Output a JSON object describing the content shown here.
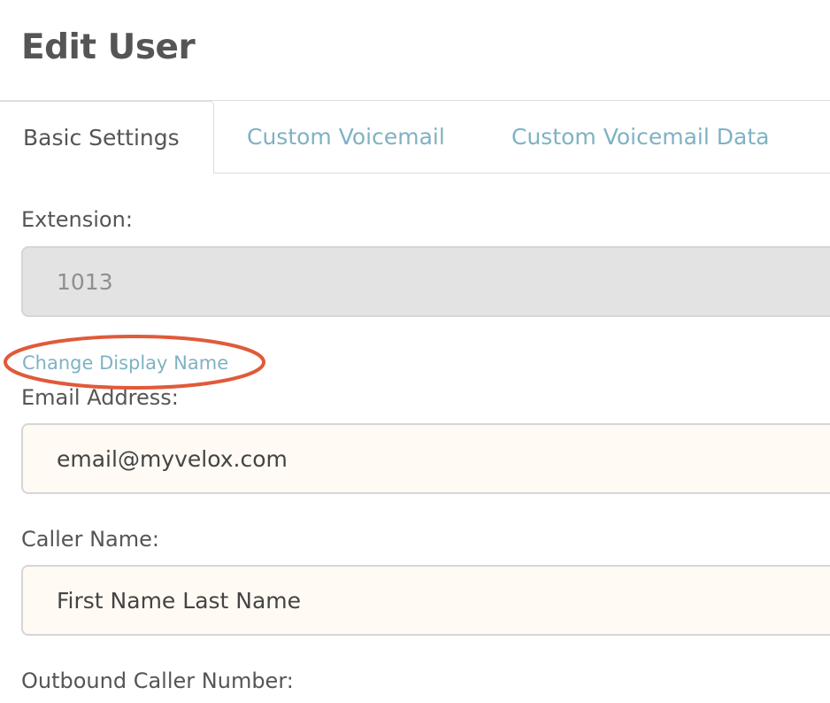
{
  "header": {
    "title": "Edit User"
  },
  "tabs": [
    {
      "label": "Basic Settings",
      "active": true
    },
    {
      "label": "Custom Voicemail",
      "active": false
    },
    {
      "label": "Custom Voicemail Data",
      "active": false
    }
  ],
  "form": {
    "extension": {
      "label": "Extension:",
      "value": "1013",
      "disabled": true
    },
    "change_display_name_link": "Change Display Name",
    "email": {
      "label": "Email Address:",
      "value": "email@myvelox.com"
    },
    "caller_name": {
      "label": "Caller Name:",
      "value": "First Name Last Name"
    },
    "outbound_caller_number": {
      "label": "Outbound Caller Number:"
    }
  },
  "annotation": {
    "type": "ellipse",
    "color": "#e05a3a"
  },
  "colors": {
    "link": "#7fb2c3",
    "text": "#555555",
    "disabled_bg": "#e3e3e3",
    "input_bg": "#fffaf3"
  }
}
